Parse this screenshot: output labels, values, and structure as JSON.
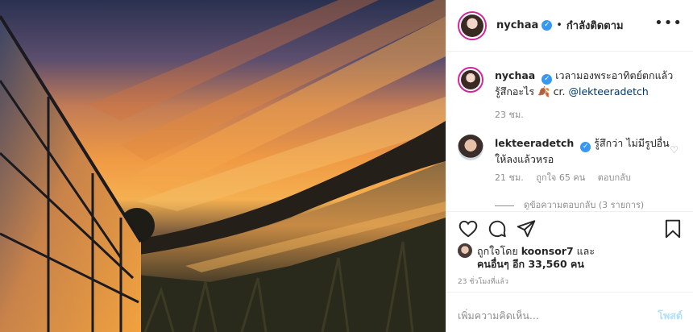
{
  "header": {
    "username": "nychaa",
    "verified_mark": "✓",
    "separator": "•",
    "follow_status": "กำลังติดตาม",
    "more": "•••"
  },
  "caption": {
    "username": "nychaa",
    "verified_mark": "✓",
    "text": "เวลามองพระอาทิตย์ตกแล้ว",
    "text2": "รู้สึกอะไร",
    "emoji": "🍂",
    "credit_prefix": " cr. ",
    "mention": "@lekteeradetch",
    "time": "23 ชม."
  },
  "comment": {
    "username": "lekteeradetch",
    "verified_mark": "✓",
    "text": "รู้สึกว่า ไม่มีรูปอื่น",
    "text2": "ให้ลงแล้วหรอ",
    "time": "21 ชม.",
    "likes": "ถูกใจ 65 คน",
    "reply": "ตอบกลับ",
    "view_replies": "ดูข้อความตอบกลับ (3 รายการ)"
  },
  "likes": {
    "line1_prefix": "ถูกใจโดย ",
    "liker": "koonsor7",
    "line1_suffix": " และ",
    "line2": "คนอื่นๆ อีก 33,560 คน"
  },
  "timestamp": "23 ชั่วโมงที่แล้ว",
  "add_comment": {
    "placeholder": "เพิ่มความคิดเห็น...",
    "post_label": "โพสต์"
  },
  "icons": {
    "heart": "heart-icon",
    "comment": "comment-icon",
    "share": "share-icon",
    "bookmark": "bookmark-icon"
  }
}
